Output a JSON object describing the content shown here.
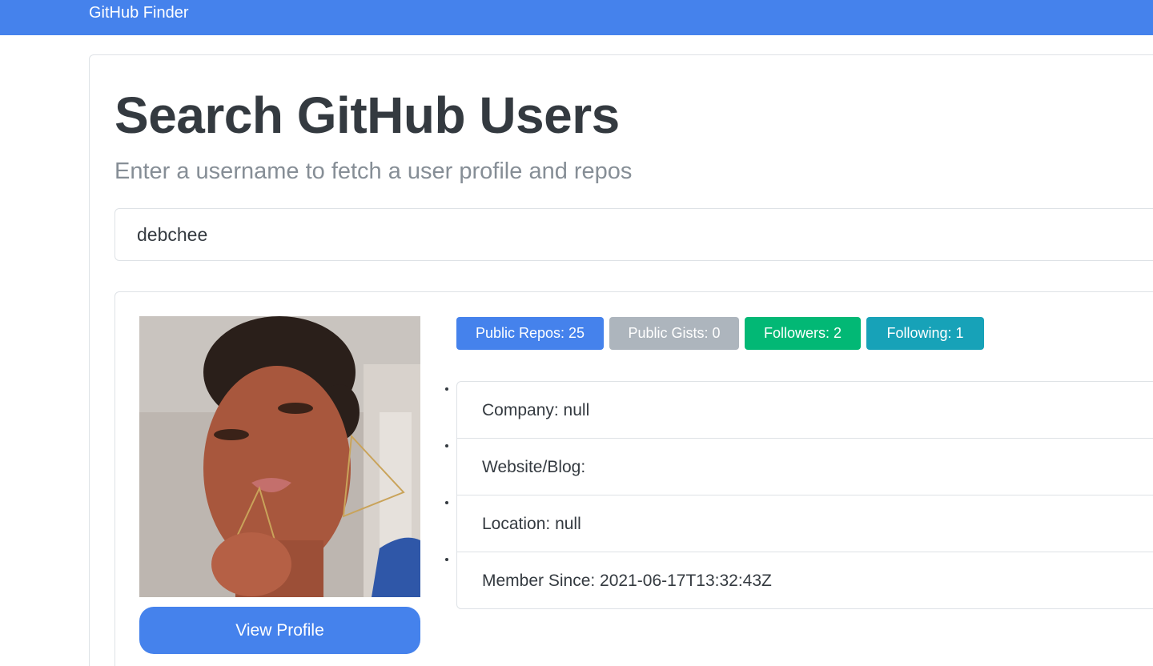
{
  "navbar": {
    "brand": "GitHub Finder"
  },
  "colors": {
    "primary": "#4582ec",
    "secondary": "#adb5bd",
    "success": "#02b875",
    "info": "#17a2b8"
  },
  "search": {
    "title": "Search GitHub Users",
    "lead": "Enter a username to fetch a user profile and repos",
    "value": "debchee"
  },
  "profile": {
    "avatar_icon": "user-avatar-photo",
    "view_profile_label": "View Profile",
    "badges": {
      "public_repos": "Public Repos: 25",
      "public_gists": "Public Gists: 0",
      "followers": "Followers: 2",
      "following": "Following: 1"
    },
    "details": {
      "company": "Company: null",
      "website": "Website/Blog:",
      "location": "Location: null",
      "member_since": "Member Since: 2021-06-17T13:32:43Z"
    }
  }
}
